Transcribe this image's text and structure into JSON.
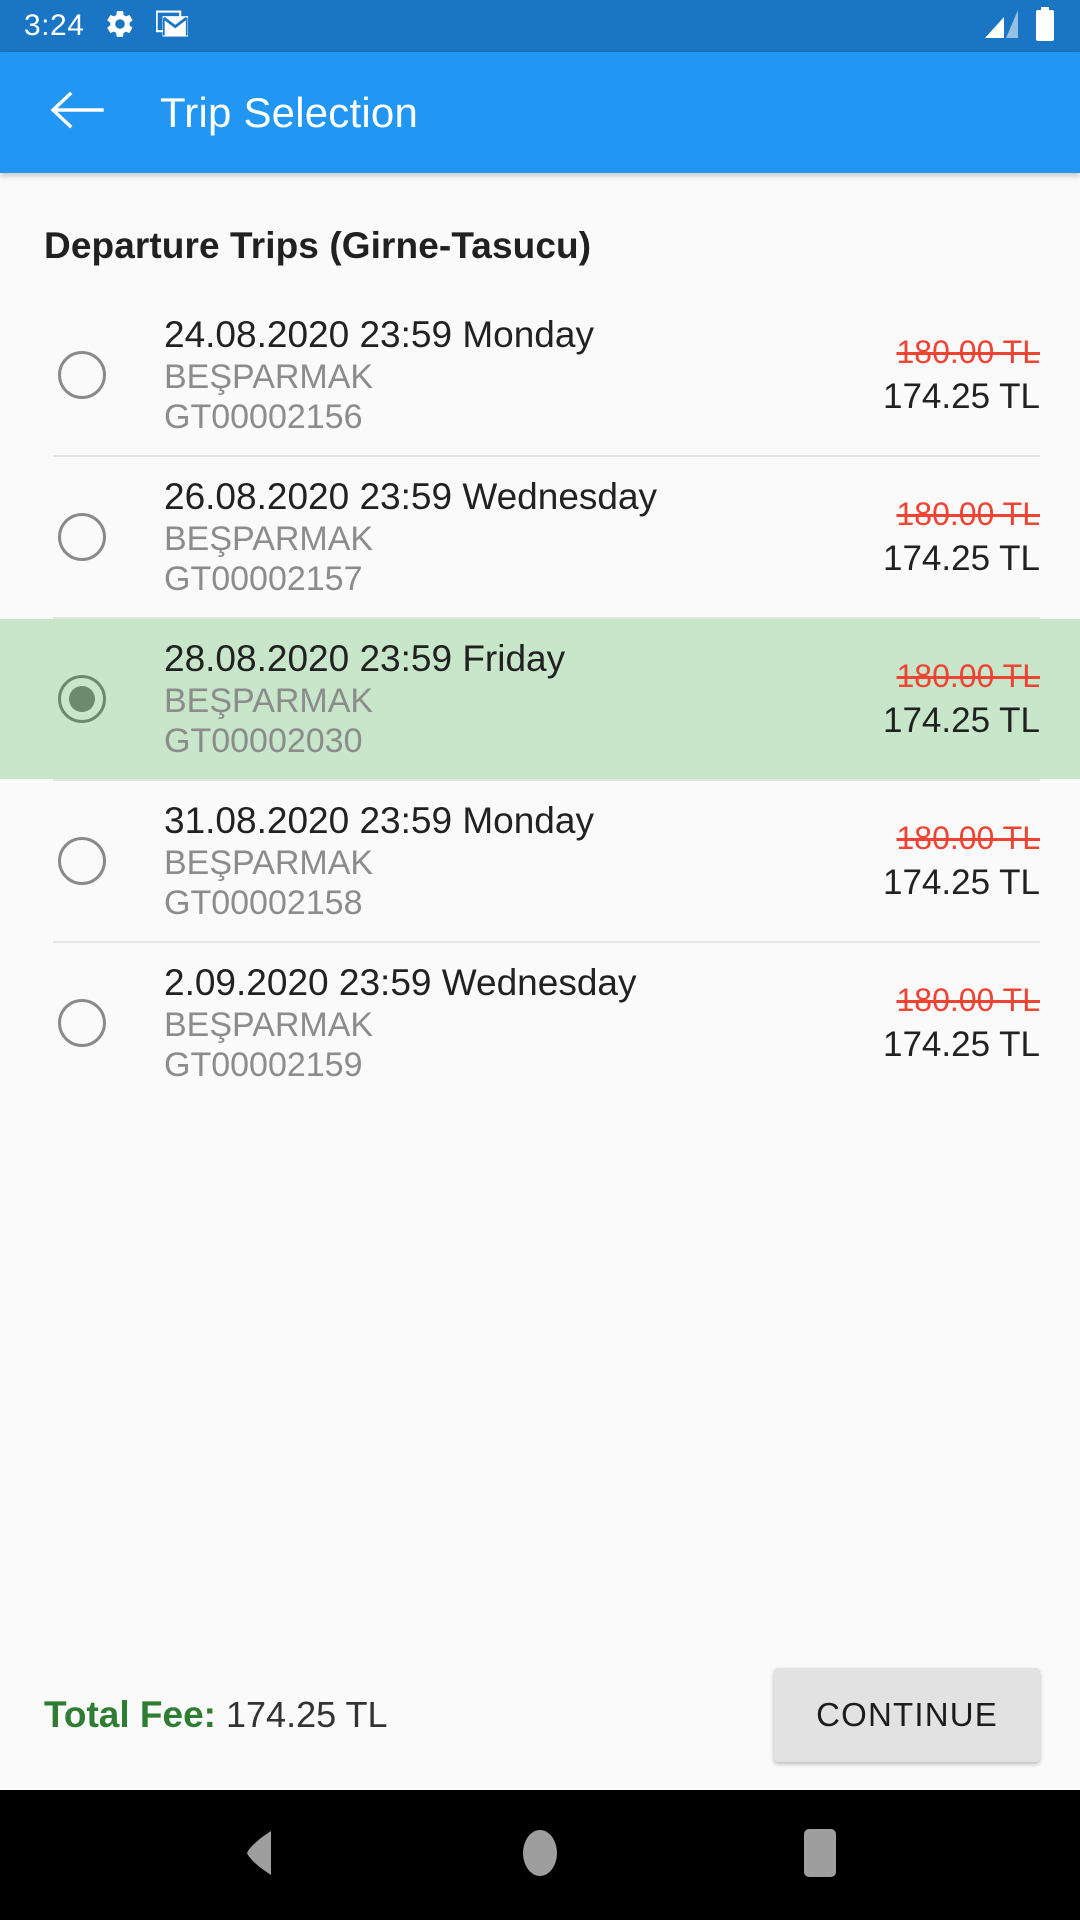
{
  "status_bar": {
    "clock": "3:24",
    "icons": [
      "gear-icon",
      "gmail-icon",
      "signal-icon",
      "battery-icon"
    ],
    "background": "#1a76c4"
  },
  "app_bar": {
    "back_label": "back-arrow",
    "title": "Trip Selection",
    "background": "#2196f3"
  },
  "main": {
    "section_title": "Departure Trips (Girne-Tasucu)",
    "selected_index": 2,
    "selected_background": "#c8e6c9",
    "old_price_color": "#ef4334",
    "trips": [
      {
        "datetime": "24.08.2020 23:59 Monday",
        "vessel": "BEŞPARMAK",
        "code": "GT00002156",
        "price_old": "180.00 TL",
        "price_new": "174.25 TL",
        "selected": false
      },
      {
        "datetime": "26.08.2020 23:59 Wednesday",
        "vessel": "BEŞPARMAK",
        "code": "GT00002157",
        "price_old": "180.00 TL",
        "price_new": "174.25 TL",
        "selected": false
      },
      {
        "datetime": "28.08.2020 23:59 Friday",
        "vessel": "BEŞPARMAK",
        "code": "GT00002030",
        "price_old": "180.00 TL",
        "price_new": "174.25 TL",
        "selected": true
      },
      {
        "datetime": "31.08.2020 23:59 Monday",
        "vessel": "BEŞPARMAK",
        "code": "GT00002158",
        "price_old": "180.00 TL",
        "price_new": "174.25 TL",
        "selected": false
      },
      {
        "datetime": "2.09.2020 23:59 Wednesday",
        "vessel": "BEŞPARMAK",
        "code": "GT00002159",
        "price_old": "180.00 TL",
        "price_new": "174.25 TL",
        "selected": false
      }
    ]
  },
  "bottom_bar": {
    "total_label": "Total Fee:",
    "total_value": "174.25 TL",
    "total_label_color": "#2e7d32",
    "continue_label": "CONTINUE"
  },
  "nav_bar": {
    "back": "nav-back-icon",
    "home": "nav-home-icon",
    "recents": "nav-recents-icon",
    "icon_color": "#9e9e9e"
  }
}
